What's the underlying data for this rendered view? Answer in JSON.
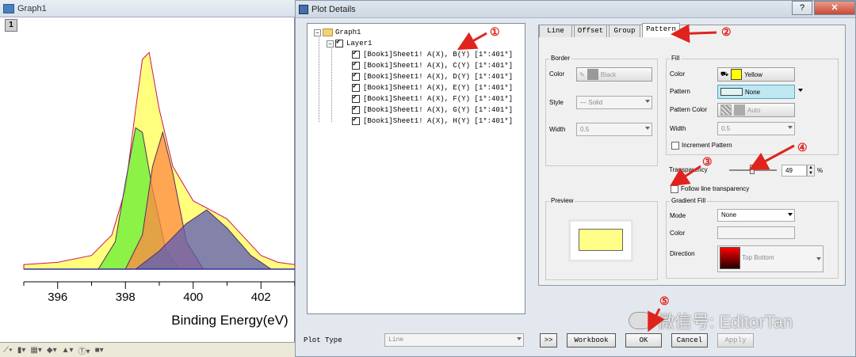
{
  "graph": {
    "title": "Graph1",
    "layer_number": "1",
    "x_ticks": [
      "396",
      "398",
      "400",
      "402"
    ],
    "x_label": "Binding Energy(eV)"
  },
  "chart_data": {
    "type": "area",
    "xlabel": "Binding Energy(eV)",
    "ylabel": "",
    "xlim": [
      395,
      403
    ],
    "grid": false,
    "series": [
      {
        "name": "",
        "color": "#ffff66",
        "x": [
          395,
          396,
          397,
          397.6,
          398,
          398.3,
          398.5,
          398.7,
          399,
          399.4,
          400,
          400.5,
          401,
          401.5,
          402,
          402.5,
          403
        ],
        "y": [
          0.02,
          0.03,
          0.06,
          0.15,
          0.35,
          0.7,
          0.92,
          0.95,
          0.7,
          0.45,
          0.3,
          0.26,
          0.22,
          0.14,
          0.06,
          0.03,
          0.02
        ]
      },
      {
        "name": "",
        "color": "#66ee33",
        "x": [
          397.2,
          397.7,
          398,
          398.3,
          398.5,
          398.8,
          399.2,
          399.6
        ],
        "y": [
          0,
          0.12,
          0.38,
          0.62,
          0.6,
          0.35,
          0.08,
          0
        ]
      },
      {
        "name": "",
        "color": "#ff8844",
        "x": [
          398,
          398.5,
          398.8,
          399.1,
          399.4,
          399.8,
          400.3
        ],
        "y": [
          0,
          0.15,
          0.45,
          0.6,
          0.42,
          0.12,
          0
        ]
      },
      {
        "name": "",
        "color": "#5a5ab8",
        "x": [
          398.3,
          399,
          399.8,
          400.4,
          401,
          401.7,
          402.3
        ],
        "y": [
          0,
          0.08,
          0.2,
          0.26,
          0.18,
          0.06,
          0
        ]
      }
    ]
  },
  "dialog": {
    "title": "Plot Details",
    "help": "?",
    "close": "✕",
    "tree": {
      "root": "Graph1",
      "layer": "Layer1",
      "items": [
        "[Book1]Sheet1! A(X), B(Y) [1*:401*]",
        "[Book1]Sheet1! A(X), C(Y) [1*:401*]",
        "[Book1]Sheet1! A(X), D(Y) [1*:401*]",
        "[Book1]Sheet1! A(X), E(Y) [1*:401*]",
        "[Book1]Sheet1! A(X), F(Y) [1*:401*]",
        "[Book1]Sheet1! A(X), G(Y) [1*:401*]",
        "[Book1]Sheet1! A(X), H(Y) [1*:401*]"
      ]
    },
    "tabs": [
      "Line",
      "Offset",
      "Group",
      "Pattern"
    ],
    "border": {
      "label": "Border",
      "color_label": "Color",
      "color_value": "Black",
      "style_label": "Style",
      "style_value": "Solid",
      "width_label": "Width",
      "width_value": "0.5"
    },
    "fill": {
      "label": "Fill",
      "color_label": "Color",
      "color_value": "Yellow",
      "color_hex": "#ffff00",
      "pattern_label": "Pattern",
      "pattern_value": "None",
      "pattern_color_label": "Pattern Color",
      "pattern_color_value": "Auto",
      "width_label": "Width",
      "width_value": "0.5",
      "increment_label": "Increment Pattern"
    },
    "transparency": {
      "label": "Transparency",
      "value": "49",
      "percent": 49,
      "unit": "%",
      "follow_label": "Follow line transparency"
    },
    "preview_label": "Preview",
    "preview_fill": "#ffff88",
    "gradient": {
      "label": "Gradient Fill",
      "mode_label": "Mode",
      "mode_value": "None",
      "color_label": "Color",
      "direction_label": "Direction",
      "direction_value": "Top Bottom"
    },
    "plot_type_label": "Plot Type",
    "plot_type_value": "Line",
    "buttons": {
      "expand": ">>",
      "workbook": "Workbook",
      "ok": "OK",
      "cancel": "Cancel",
      "apply": "Apply"
    }
  },
  "annotations": [
    "①",
    "②",
    "③",
    "④",
    "⑤"
  ],
  "watermark": "微信号: EditorTan"
}
